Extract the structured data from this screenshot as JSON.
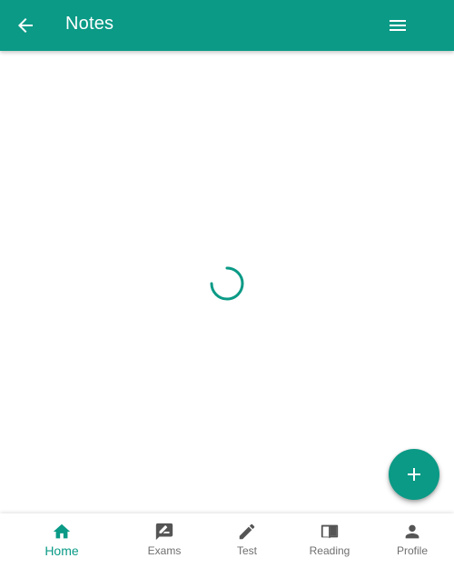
{
  "header": {
    "title": "Notes",
    "back_icon": "arrow-back-icon",
    "menu_icon": "menu-icon"
  },
  "content": {
    "loading": true
  },
  "fab": {
    "icon": "plus-icon"
  },
  "bottom_nav": {
    "items": [
      {
        "label": "Home",
        "icon": "home-icon",
        "active": true
      },
      {
        "label": "Exams",
        "icon": "rate-review-icon",
        "active": false
      },
      {
        "label": "Test",
        "icon": "pencil-icon",
        "active": false
      },
      {
        "label": "Reading",
        "icon": "book-open-icon",
        "active": false
      },
      {
        "label": "Profile",
        "icon": "person-icon",
        "active": false
      }
    ]
  },
  "colors": {
    "primary": "#0a9a86",
    "inactive": "#6f6f6f",
    "surface": "#ffffff"
  }
}
